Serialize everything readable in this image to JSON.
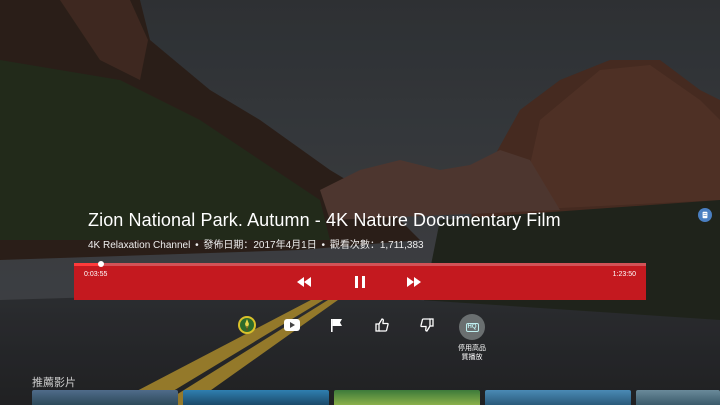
{
  "video": {
    "title": "Zion National Park. Autumn - 4K Nature Documentary Film",
    "channel": "4K Relaxation Channel",
    "dot": "•",
    "published": "發佈日期：2017年4月1日",
    "views": "觀看次數：1,711,383"
  },
  "player": {
    "current_time": "0:03:55",
    "total_time": "1:23:50",
    "progress_fraction": 0.047,
    "accent_color": "#c4191f"
  },
  "controls": {
    "rewind_icon": "rewind-icon",
    "pause_icon": "pause-icon",
    "fast_forward_icon": "fast-forward-icon"
  },
  "actions": {
    "channel_icon": "channel-avatar-icon",
    "youtube_icon": "youtube-icon",
    "flag_icon": "flag-icon",
    "like_icon": "thumbs-up-icon",
    "dislike_icon": "thumbs-down-icon",
    "hq_badge": "HQ",
    "hq_label_line1": "停用高品",
    "hq_label_line2": "質播放"
  },
  "recommended": {
    "heading": "推薦影片"
  }
}
